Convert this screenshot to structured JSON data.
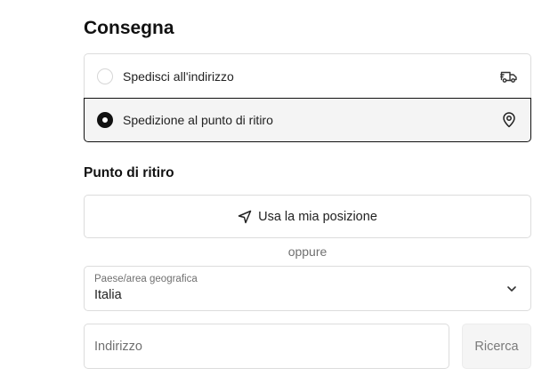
{
  "delivery": {
    "title": "Consegna",
    "options": [
      {
        "label": "Spedisci all'indirizzo",
        "icon": "truck-icon",
        "selected": false
      },
      {
        "label": "Spedizione al punto di ritiro",
        "icon": "map-pin-icon",
        "selected": true
      }
    ]
  },
  "pickup": {
    "title": "Punto di ritiro",
    "use_location_label": "Usa la mia posizione",
    "use_location_icon": "navigation-arrow-icon",
    "divider_text": "oppure",
    "country": {
      "label": "Paese/area geografica",
      "value": "Italia",
      "icon": "chevron-down-icon"
    },
    "address": {
      "placeholder": "Indirizzo",
      "value": ""
    },
    "search_label": "Ricerca"
  },
  "colors": {
    "selected_border": "#111111",
    "selected_bg": "#f4f4f4",
    "border": "#dcdcdc",
    "muted_text": "#707070"
  }
}
